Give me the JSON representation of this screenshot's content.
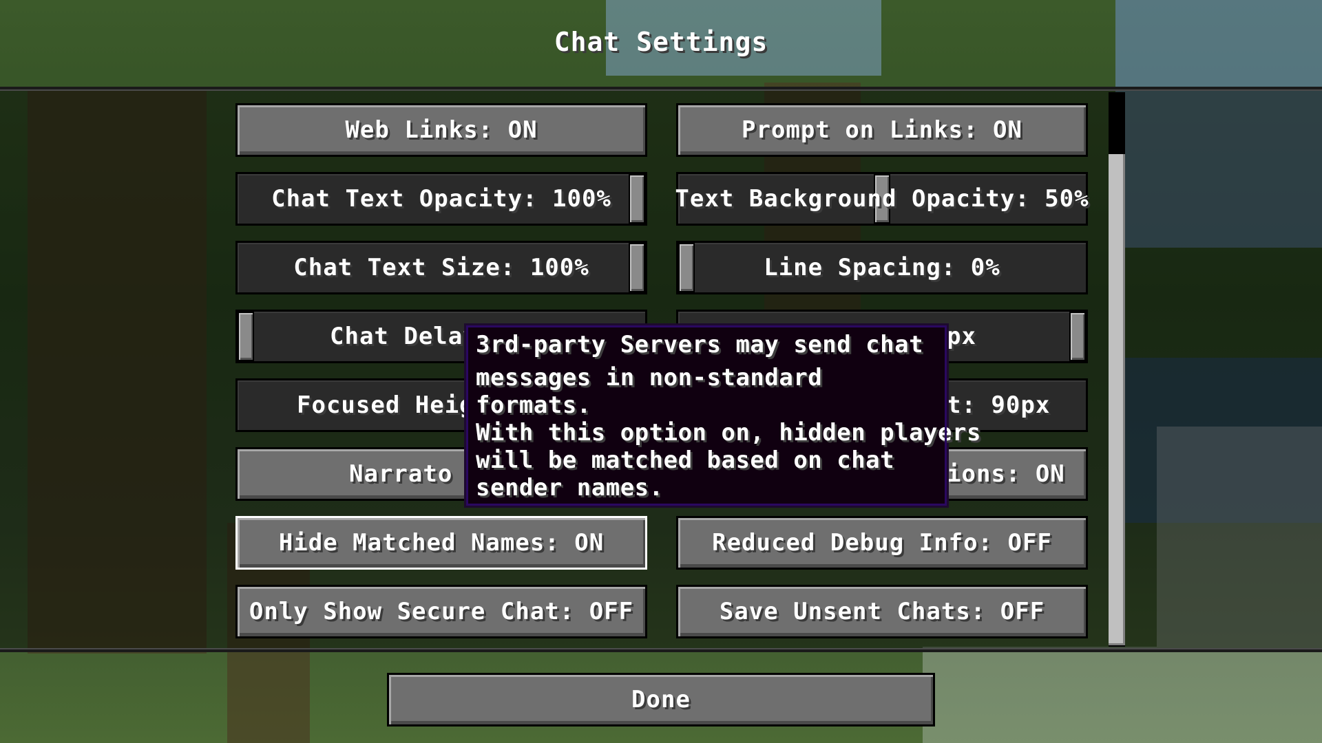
{
  "screen": {
    "title": "Chat Settings"
  },
  "options": {
    "web_links": "Web Links: ON",
    "prompt_on_links": "Prompt on Links: ON",
    "chat_text_opacity": "Chat Text Opacity: 100%",
    "chat_text_opacity_level": 1.0,
    "text_background_opacity": "Text Background Opacity: 50%",
    "text_background_opacity_level": 0.5,
    "chat_text_size": "Chat Text Size: 100%",
    "chat_text_size_level": 1.0,
    "line_spacing": "Line Spacing: 0%",
    "line_spacing_level": 0.0,
    "chat_delay": "Chat Delay",
    "chat_delay_level": 0.0,
    "chat_width": "px",
    "chat_width_level": 1.0,
    "focused_height": "Focused Heig",
    "unfocused_height": "t: 90px",
    "narrator": "Narrato",
    "command_suggestions": "ions: ON",
    "hide_matched_names": "Hide Matched Names: ON",
    "reduced_debug_info": "Reduced Debug Info: OFF",
    "only_show_secure_chat": "Only Show Secure Chat: OFF",
    "save_unsent_chats": "Save Unsent Chats: OFF"
  },
  "tooltip": {
    "lines": [
      "3rd-party Servers may send chat",
      "messages in non-standard",
      "formats.",
      "With this option on, hidden players",
      "will be matched based on chat",
      "sender names."
    ]
  },
  "footer": {
    "done_label": "Done"
  }
}
